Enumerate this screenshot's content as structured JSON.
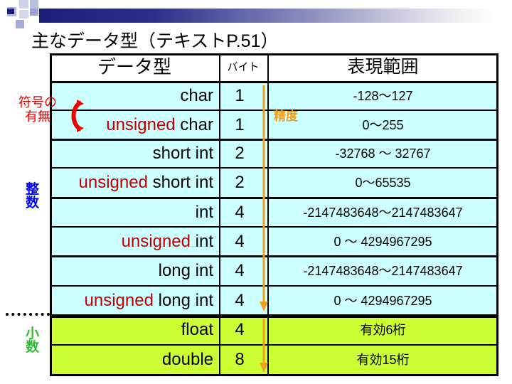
{
  "slide": {
    "title": "主なデータ型（テキストP.51）"
  },
  "table": {
    "headers": {
      "type": "データ型",
      "bytes": "バイト",
      "range": "表現範囲"
    },
    "rows": [
      {
        "prefix": "",
        "type": "char",
        "bytes": "1",
        "range": "-128～127",
        "group": "integer"
      },
      {
        "prefix": "unsigned",
        "type": " char",
        "bytes": "1",
        "range": "0～255",
        "group": "integer"
      },
      {
        "prefix": "",
        "type": "short int",
        "bytes": "2",
        "range": "-32768 ～ 32767",
        "group": "integer"
      },
      {
        "prefix": "unsigned",
        "type": " short int",
        "bytes": "2",
        "range": "0～65535",
        "group": "integer"
      },
      {
        "prefix": "",
        "type": "int",
        "bytes": "4",
        "range": "-2147483648～2147483647",
        "group": "integer"
      },
      {
        "prefix": "unsigned",
        "type": " int",
        "bytes": "4",
        "range": "0 ～ 4294967295",
        "group": "integer"
      },
      {
        "prefix": "",
        "type": "long int",
        "bytes": "4",
        "range": "-2147483648～2147483647",
        "group": "integer"
      },
      {
        "prefix": "unsigned",
        "type": " long int",
        "bytes": "4",
        "range": "0 ～ 4294967295",
        "group": "integer"
      },
      {
        "prefix": "",
        "type": "float",
        "bytes": "4",
        "range": "有効6桁",
        "group": "decimal"
      },
      {
        "prefix": "",
        "type": "double",
        "bytes": "8",
        "range": "有効15桁",
        "group": "decimal"
      }
    ]
  },
  "annotations": {
    "signedness_label_line1": "符号の",
    "signedness_label_line2": "有無",
    "integer_label_line1": "整",
    "integer_label_line2": "数",
    "decimal_label_line1": "小",
    "decimal_label_line2": "数",
    "precision_label": "精度",
    "arrow_icon": "curved-arrow-icon",
    "precision_arrow_icon": "down-arrow-icon"
  },
  "colors": {
    "integer_row_bg": "#ccffff",
    "decimal_row_bg": "#ccff33",
    "unsigned_text": "#c00000",
    "signedness_label": "#e60000",
    "integer_label": "#0000ff",
    "decimal_label": "#33cc33",
    "precision": "#f0a020",
    "title_bar_dark": "#1b1f7a"
  }
}
